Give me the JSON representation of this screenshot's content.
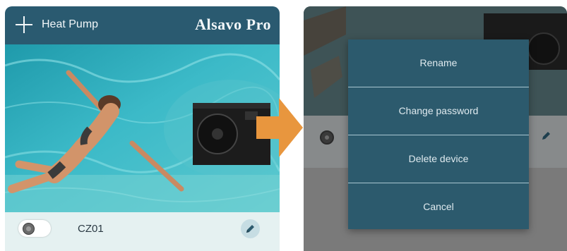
{
  "left_screen": {
    "topbar": {
      "title": "Heat Pump",
      "brand": "Alsavo Pro"
    },
    "device": {
      "name": "CZ01"
    }
  },
  "right_screen": {
    "menu": {
      "items": [
        {
          "label": "Rename"
        },
        {
          "label": "Change password"
        },
        {
          "label": "Delete device"
        },
        {
          "label": "Cancel"
        }
      ]
    }
  },
  "colors": {
    "header": "#2a5a70",
    "menu": "#2c5a6d",
    "arrow": "#e8963e",
    "row_background": "#e5f1f1"
  },
  "icons": [
    "plus-icon",
    "pencil-icon",
    "arrow-right-icon",
    "toggle-knob"
  ]
}
